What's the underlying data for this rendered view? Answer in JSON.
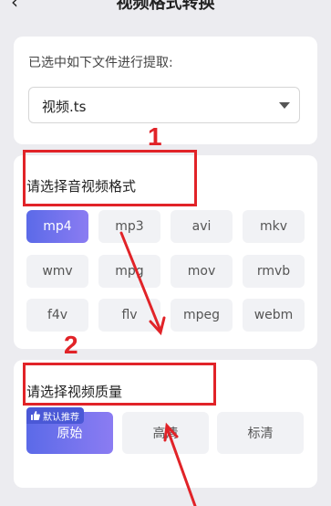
{
  "header": {
    "title": "视频格式转换",
    "back_icon": "chevron-left-icon"
  },
  "file_section": {
    "caption": "已选中如下文件进行提取:",
    "selected_file": "视频.ts"
  },
  "format_section": {
    "title": "请选择音视频格式",
    "options": [
      "mp4",
      "mp3",
      "avi",
      "mkv",
      "wmv",
      "mpg",
      "mov",
      "rmvb",
      "f4v",
      "flv",
      "mpeg",
      "webm"
    ],
    "selected": "mp4"
  },
  "quality_section": {
    "title": "请选择视频质量",
    "badge": "默认推荐",
    "options": [
      "原始",
      "高清",
      "标清"
    ],
    "selected": "原始"
  },
  "annotations": {
    "step1": "1",
    "step2": "2",
    "color": "#e12328"
  },
  "colors": {
    "accent_start": "#5b6ae8",
    "accent_end": "#8b7cf2",
    "background": "#ececf0"
  }
}
